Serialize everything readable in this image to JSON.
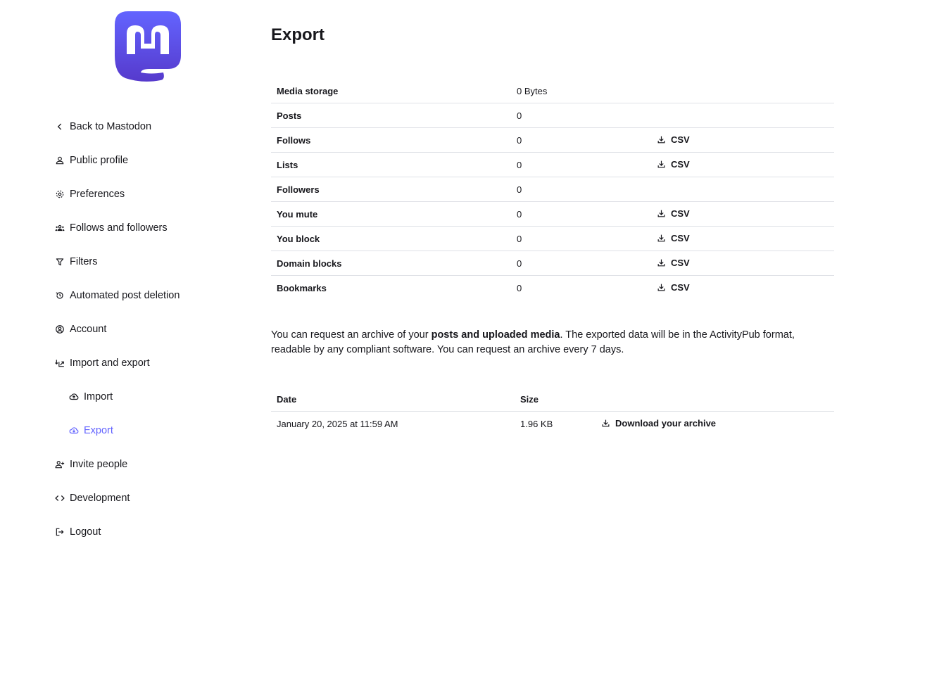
{
  "sidebar": {
    "logo": "mastodon-logo",
    "items": [
      {
        "label": "Back to Mastodon",
        "icon": "chevron-left-icon",
        "active": false
      },
      {
        "label": "Public profile",
        "icon": "person-icon",
        "active": false
      },
      {
        "label": "Preferences",
        "icon": "gear-icon",
        "active": false
      },
      {
        "label": "Follows and followers",
        "icon": "group-icon",
        "active": false
      },
      {
        "label": "Filters",
        "icon": "filter-icon",
        "active": false
      },
      {
        "label": "Automated post deletion",
        "icon": "history-icon",
        "active": false
      },
      {
        "label": "Account",
        "icon": "account-circle-icon",
        "active": false
      },
      {
        "label": "Import and export",
        "icon": "import-export-icon",
        "active": false
      },
      {
        "label": "Import",
        "icon": "cloud-upload-icon",
        "active": false
      },
      {
        "label": "Export",
        "icon": "cloud-download-icon",
        "active": true
      },
      {
        "label": "Invite people",
        "icon": "person-add-icon",
        "active": false
      },
      {
        "label": "Development",
        "icon": "code-icon",
        "active": false
      },
      {
        "label": "Logout",
        "icon": "logout-icon",
        "active": false
      }
    ]
  },
  "main": {
    "title": "Export",
    "csv_label": "CSV",
    "stats": [
      {
        "label": "Media storage",
        "value": "0 Bytes",
        "csv": false
      },
      {
        "label": "Posts",
        "value": "0",
        "csv": false
      },
      {
        "label": "Follows",
        "value": "0",
        "csv": true
      },
      {
        "label": "Lists",
        "value": "0",
        "csv": true
      },
      {
        "label": "Followers",
        "value": "0",
        "csv": false
      },
      {
        "label": "You mute",
        "value": "0",
        "csv": true
      },
      {
        "label": "You block",
        "value": "0",
        "csv": true
      },
      {
        "label": "Domain blocks",
        "value": "0",
        "csv": true
      },
      {
        "label": "Bookmarks",
        "value": "0",
        "csv": true
      }
    ],
    "hint": {
      "before": "You can request an archive of your ",
      "bold": "posts and uploaded media",
      "after": ". The exported data will be in the ActivityPub format, readable by any compliant software. You can request an archive every 7 days."
    },
    "archive_table": {
      "headers": {
        "date": "Date",
        "size": "Size"
      },
      "rows": [
        {
          "date": "January 20, 2025 at 11:59 AM",
          "size": "1.96 KB",
          "action": "Download your archive"
        }
      ]
    }
  },
  "colors": {
    "accent": "#6364ff",
    "logo_top": "#6364ff",
    "logo_bottom": "#563acc",
    "text": "#17171c",
    "divider": "#dfe1e6"
  }
}
